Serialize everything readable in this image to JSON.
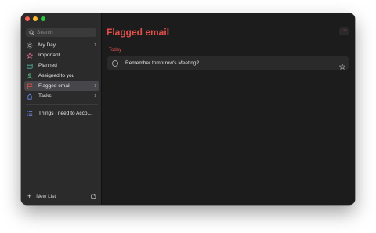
{
  "window": {
    "traffic_lights": [
      "#ff5f57",
      "#febc2e",
      "#28c840"
    ]
  },
  "sidebar": {
    "search_placeholder": "Search",
    "items": [
      {
        "label": "My Day",
        "count": "1",
        "icon": "sun-icon"
      },
      {
        "label": "Important",
        "count": "",
        "icon": "star-icon"
      },
      {
        "label": "Planned",
        "count": "",
        "icon": "calendar-icon"
      },
      {
        "label": "Assigned to you",
        "count": "",
        "icon": "person-icon"
      },
      {
        "label": "Flagged email",
        "count": "1",
        "icon": "flag-icon",
        "active": true
      },
      {
        "label": "Tasks",
        "count": "1",
        "icon": "home-icon"
      }
    ],
    "lists": [
      {
        "label": "Things I need to Acco...",
        "icon": "list-icon"
      }
    ],
    "new_list_label": "New List"
  },
  "main": {
    "title": "Flagged email",
    "more_label": "···",
    "section_label": "Today",
    "tasks": [
      {
        "text": "Remember tomorrow's Meeting?"
      }
    ]
  },
  "colors": {
    "accent": "#e2504a",
    "sidebar_bg": "#2c2b2b",
    "main_bg": "#1c1c1c",
    "selected_bg": "#47464a"
  }
}
